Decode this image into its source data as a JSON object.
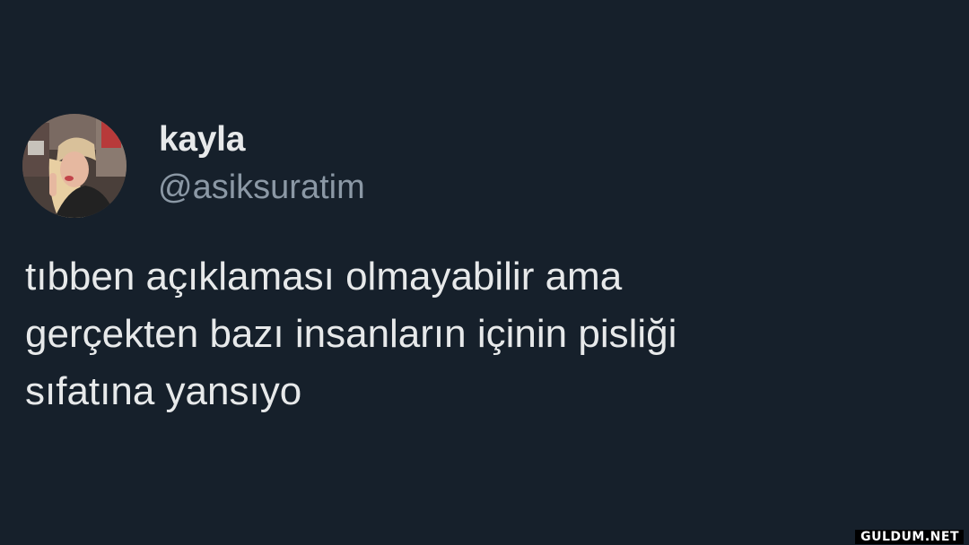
{
  "tweet": {
    "author": {
      "display_name": "kayla",
      "handle": "@asiksuratim",
      "avatar": "profile-photo"
    },
    "text_lines": [
      "tıbben açıklaması olmayabilir ama",
      "gerçekten bazı insanların içinin pisliği",
      "sıfatına yansıyo"
    ]
  },
  "watermark": {
    "text": "GULDUM.NET"
  },
  "colors": {
    "background": "#16202b",
    "primary_text": "#e7e9ea",
    "secondary_text": "#8b98a5"
  }
}
